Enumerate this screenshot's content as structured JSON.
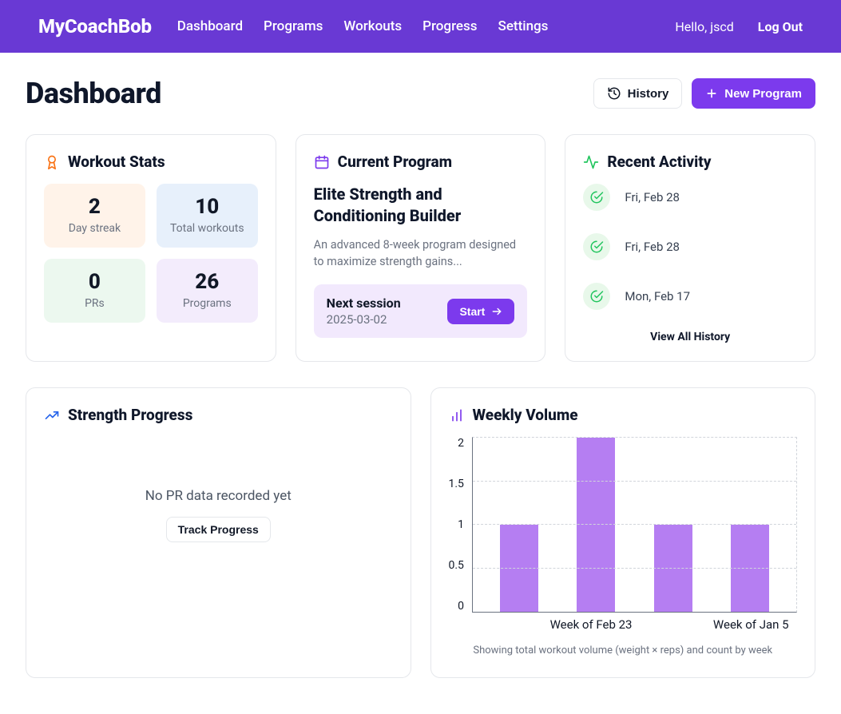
{
  "header": {
    "brand": "MyCoachBob",
    "nav": [
      "Dashboard",
      "Programs",
      "Workouts",
      "Progress",
      "Settings"
    ],
    "greeting": "Hello, jscd",
    "logout": "Log Out"
  },
  "page": {
    "title": "Dashboard",
    "history_btn": "History",
    "new_program_btn": "New Program"
  },
  "stats_card": {
    "title": "Workout Stats",
    "tiles": [
      {
        "value": "2",
        "label": "Day streak"
      },
      {
        "value": "10",
        "label": "Total workouts"
      },
      {
        "value": "0",
        "label": "PRs"
      },
      {
        "value": "26",
        "label": "Programs"
      }
    ]
  },
  "program_card": {
    "title": "Current Program",
    "name": "Elite Strength and Conditioning Builder",
    "description": "An advanced 8-week program designed to maximize strength gains...",
    "next_session_label": "Next session",
    "next_session_date": "2025-03-02",
    "start_btn": "Start"
  },
  "activity_card": {
    "title": "Recent Activity",
    "items": [
      "Fri, Feb 28",
      "Fri, Feb 28",
      "Mon, Feb 17"
    ],
    "view_all": "View All History"
  },
  "strength_card": {
    "title": "Strength Progress",
    "empty_text": "No PR data recorded yet",
    "track_btn": "Track Progress"
  },
  "volume_card": {
    "title": "Weekly Volume",
    "caption": "Showing total workout volume (weight × reps) and count by week"
  },
  "chart_data": {
    "type": "bar",
    "categories": [
      "",
      "Week of Feb 23",
      "",
      "Week of Jan 5"
    ],
    "values": [
      1,
      2,
      1,
      1
    ],
    "title": "Weekly Volume",
    "xlabel": "",
    "ylabel": "",
    "ylim": [
      0,
      2
    ],
    "yticks": [
      0,
      0.5,
      1,
      1.5,
      2
    ],
    "bar_color": "#b57ef2"
  }
}
